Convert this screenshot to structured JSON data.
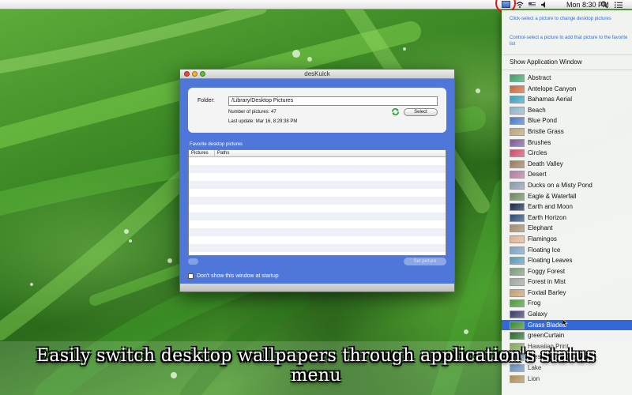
{
  "menubar": {
    "clock": "Mon 8:30 PM"
  },
  "window": {
    "title": "desKuick",
    "folder_label": "Folder:",
    "folder_value": "/Library/Desktop Pictures",
    "num_pictures": "Number of pictures: 47",
    "last_update": "Last update: Mar 16, 8:29:38 PM",
    "select_label": "Select",
    "favorites_label": "Favorite desktop pictures",
    "columns": [
      "Pictures",
      "Paths"
    ],
    "set_picture_label": "Set picture",
    "startup_label": "Don't show this window at startup"
  },
  "status_menu": {
    "hint_1": "Click-select a picture to change desktop pictures",
    "hint_2": "Control-select a picture to add that picture to the favorite list",
    "show_window": "Show Application Window",
    "items": [
      {
        "label": "Abstract",
        "color": "#3fa06a"
      },
      {
        "label": "Antelope Canyon",
        "color": "#c8683a"
      },
      {
        "label": "Bahamas Aerial",
        "color": "#3a9fc0"
      },
      {
        "label": "Beach",
        "color": "#8fb4c9"
      },
      {
        "label": "Blue Pond",
        "color": "#4a79c4"
      },
      {
        "label": "Bristle Grass",
        "color": "#b8a37a"
      },
      {
        "label": "Brushes",
        "color": "#7a5a9a"
      },
      {
        "label": "Circles",
        "color": "#d04a6a"
      },
      {
        "label": "Death Valley",
        "color": "#9a7a5a"
      },
      {
        "label": "Desert",
        "color": "#b07aa0"
      },
      {
        "label": "Ducks on a Misty Pond",
        "color": "#8a9aa8"
      },
      {
        "label": "Eagle & Waterfall",
        "color": "#6a8a5a"
      },
      {
        "label": "Earth and Moon",
        "color": "#1a2a4a"
      },
      {
        "label": "Earth Horizon",
        "color": "#2a4a7a"
      },
      {
        "label": "Elephant",
        "color": "#a08a6a"
      },
      {
        "label": "Flamingos",
        "color": "#e0b090"
      },
      {
        "label": "Floating Ice",
        "color": "#7aa0c0"
      },
      {
        "label": "Floating Leaves",
        "color": "#5a9ab0"
      },
      {
        "label": "Foggy Forest",
        "color": "#7a9a7a"
      },
      {
        "label": "Forest in Mist",
        "color": "#9aa89a"
      },
      {
        "label": "Foxtail Barley",
        "color": "#c0a070"
      },
      {
        "label": "Frog",
        "color": "#4a9a3a"
      },
      {
        "label": "Galaxy",
        "color": "#3a3a6a"
      },
      {
        "label": "Grass Blades",
        "color": "#3a8a2a",
        "selected": true
      },
      {
        "label": "greenCurtain",
        "color": "#2a6a2a"
      },
      {
        "label": "Hawaiian Print",
        "color": "#6a9a3a"
      },
      {
        "label": "Isles",
        "color": "#5a8aa0"
      },
      {
        "label": "Lake",
        "color": "#4a7ab0"
      },
      {
        "label": "Lion",
        "color": "#a07a3a"
      }
    ]
  },
  "caption": "Easily switch desktop wallpapers through application's status menu"
}
